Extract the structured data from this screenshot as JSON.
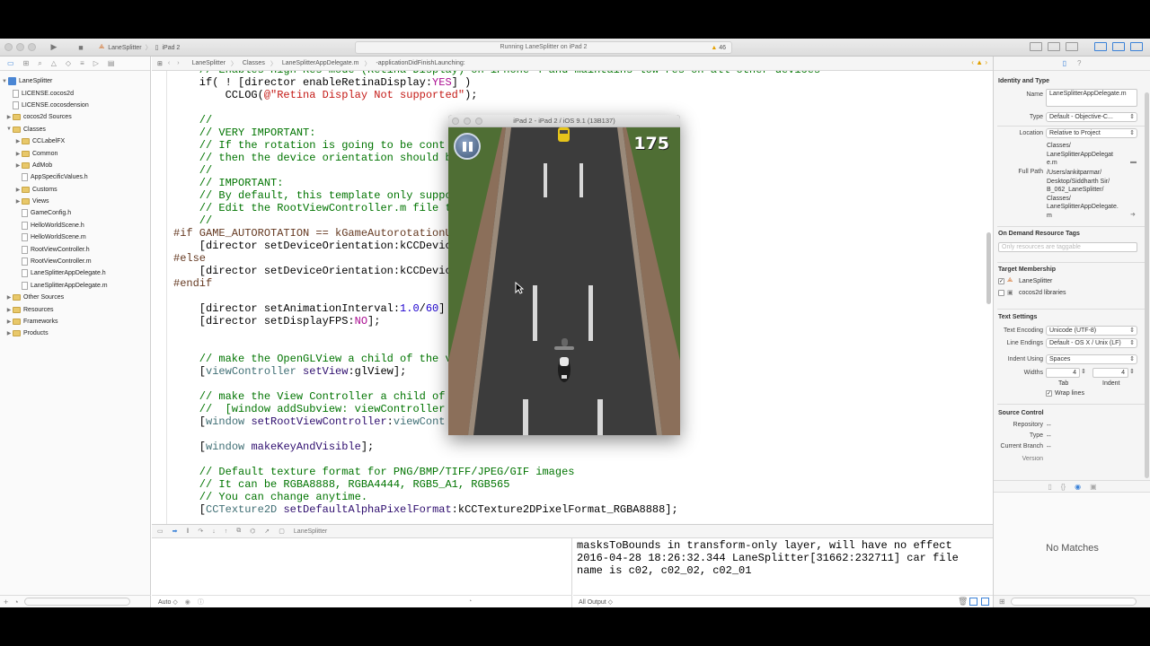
{
  "toolbar": {
    "scheme_target": "LaneSplitter",
    "scheme_device": "iPad 2",
    "activity": "Running LaneSplitter on iPad 2",
    "warnings": "46"
  },
  "jumpbar": {
    "crumbs": [
      "LaneSplitter",
      "Classes",
      "LaneSplitterAppDelegate.m",
      "-applicationDidFinishLaunching:"
    ]
  },
  "navigator": {
    "items": [
      {
        "label": "LaneSplitter",
        "kind": "project",
        "indent": 0,
        "open": true
      },
      {
        "label": "LICENSE.cocos2d",
        "kind": "file",
        "indent": 1
      },
      {
        "label": "LICENSE.cocosdension",
        "kind": "file",
        "indent": 1
      },
      {
        "label": "cocos2d Sources",
        "kind": "folder",
        "indent": 1,
        "open": false
      },
      {
        "label": "Classes",
        "kind": "folder",
        "indent": 1,
        "open": true
      },
      {
        "label": "CCLabelFX",
        "kind": "folder",
        "indent": 2,
        "open": false
      },
      {
        "label": "Common",
        "kind": "folder",
        "indent": 2,
        "open": false
      },
      {
        "label": "AdMob",
        "kind": "folder",
        "indent": 2,
        "open": false
      },
      {
        "label": "AppSpecificValues.h",
        "kind": "file",
        "indent": 2
      },
      {
        "label": "Customs",
        "kind": "folder",
        "indent": 2,
        "open": false
      },
      {
        "label": "Views",
        "kind": "folder",
        "indent": 2,
        "open": false
      },
      {
        "label": "GameConfig.h",
        "kind": "file",
        "indent": 2
      },
      {
        "label": "HelloWorldScene.h",
        "kind": "file",
        "indent": 2
      },
      {
        "label": "HelloWorldScene.m",
        "kind": "file",
        "indent": 2
      },
      {
        "label": "RootViewController.h",
        "kind": "file",
        "indent": 2
      },
      {
        "label": "RootViewController.m",
        "kind": "file",
        "indent": 2
      },
      {
        "label": "LaneSplitterAppDelegate.h",
        "kind": "file",
        "indent": 2
      },
      {
        "label": "LaneSplitterAppDelegate.m",
        "kind": "file",
        "indent": 2
      },
      {
        "label": "Other Sources",
        "kind": "folder",
        "indent": 1,
        "open": false
      },
      {
        "label": "Resources",
        "kind": "folder",
        "indent": 1,
        "open": false
      },
      {
        "label": "Frameworks",
        "kind": "folder",
        "indent": 1,
        "open": false
      },
      {
        "label": "Products",
        "kind": "folder",
        "indent": 1,
        "open": false
      }
    ]
  },
  "editor": {
    "lines": [
      [
        {
          "t": "    // Enables High Res mode (Retina Display) on iPhone 4 and maintains low res on all other devices",
          "c": "c"
        }
      ],
      [
        {
          "t": "    if( ! [director enableRetinaDisplay:",
          "c": ""
        },
        {
          "t": "YES",
          "c": "k"
        },
        {
          "t": "] )",
          "c": ""
        }
      ],
      [
        {
          "t": "        CCLOG(",
          "c": ""
        },
        {
          "t": "@\"Retina Display Not supported\"",
          "c": "s"
        },
        {
          "t": ");",
          "c": ""
        }
      ],
      [
        {
          "t": "",
          "c": ""
        }
      ],
      [
        {
          "t": "    //",
          "c": "c"
        }
      ],
      [
        {
          "t": "    // VERY IMPORTANT:",
          "c": "c"
        }
      ],
      [
        {
          "t": "    // If the rotation is going to be cont",
          "c": "c"
        }
      ],
      [
        {
          "t": "    // then the device orientation should b",
          "c": "c"
        }
      ],
      [
        {
          "t": "    //",
          "c": "c"
        }
      ],
      [
        {
          "t": "    // IMPORTANT:",
          "c": "c"
        }
      ],
      [
        {
          "t": "    // By default, this template only suppo",
          "c": "c"
        }
      ],
      [
        {
          "t": "    // Edit the RootViewController.m file t",
          "c": "c"
        }
      ],
      [
        {
          "t": "    //",
          "c": "c"
        }
      ],
      [
        {
          "t": "#if GAME_AUTOROTATION == kGameAutorotationU",
          "c": "p"
        }
      ],
      [
        {
          "t": "    [director setDeviceOrientation:kCCDevic",
          "c": ""
        }
      ],
      [
        {
          "t": "#else",
          "c": "p"
        }
      ],
      [
        {
          "t": "    [director setDeviceOrientation:kCCDevic",
          "c": ""
        }
      ],
      [
        {
          "t": "#endif",
          "c": "p"
        }
      ],
      [
        {
          "t": "",
          "c": ""
        }
      ],
      [
        {
          "t": "    [director setAnimationInterval:",
          "c": ""
        },
        {
          "t": "1.0",
          "c": "n"
        },
        {
          "t": "/",
          "c": ""
        },
        {
          "t": "60",
          "c": "n"
        },
        {
          "t": "]",
          "c": ""
        }
      ],
      [
        {
          "t": "    [director setDisplayFPS:",
          "c": ""
        },
        {
          "t": "NO",
          "c": "k"
        },
        {
          "t": "];",
          "c": ""
        }
      ],
      [
        {
          "t": "",
          "c": ""
        }
      ],
      [
        {
          "t": "",
          "c": ""
        }
      ],
      [
        {
          "t": "    // make the OpenGLView a child of the v",
          "c": "c"
        }
      ],
      [
        {
          "t": "    [",
          "c": ""
        },
        {
          "t": "viewController",
          "c": "t"
        },
        {
          "t": " ",
          "c": ""
        },
        {
          "t": "setView",
          "c": "m"
        },
        {
          "t": ":glView];",
          "c": ""
        }
      ],
      [
        {
          "t": "",
          "c": ""
        }
      ],
      [
        {
          "t": "    // make the View Controller a child of",
          "c": "c"
        }
      ],
      [
        {
          "t": "    //  [window addSubview: viewController",
          "c": "c"
        }
      ],
      [
        {
          "t": "    [",
          "c": ""
        },
        {
          "t": "window",
          "c": "t"
        },
        {
          "t": " ",
          "c": ""
        },
        {
          "t": "setRootViewController",
          "c": "m"
        },
        {
          "t": ":",
          "c": ""
        },
        {
          "t": "viewCont",
          "c": "t"
        }
      ],
      [
        {
          "t": "",
          "c": ""
        }
      ],
      [
        {
          "t": "    [",
          "c": ""
        },
        {
          "t": "window",
          "c": "t"
        },
        {
          "t": " ",
          "c": ""
        },
        {
          "t": "makeKeyAndVisible",
          "c": "m"
        },
        {
          "t": "];",
          "c": ""
        }
      ],
      [
        {
          "t": "",
          "c": ""
        }
      ],
      [
        {
          "t": "    // Default texture format for PNG/BMP/TIFF/JPEG/GIF images",
          "c": "c"
        }
      ],
      [
        {
          "t": "    // It can be RGBA8888, RGBA4444, RGB5_A1, RGB565",
          "c": "c"
        }
      ],
      [
        {
          "t": "    // You can change anytime.",
          "c": "c"
        }
      ],
      [
        {
          "t": "    [",
          "c": ""
        },
        {
          "t": "CCTexture2D",
          "c": "t"
        },
        {
          "t": " ",
          "c": ""
        },
        {
          "t": "setDefaultAlphaPixelFormat",
          "c": "m"
        },
        {
          "t": ":kCCTexture2DPixelFormat_RGBA8888];",
          "c": ""
        }
      ]
    ]
  },
  "debugbar": {
    "target": "LaneSplitter"
  },
  "variables": {
    "filter_label": "Auto ◇"
  },
  "console": {
    "text": "masksToBounds in transform-only layer, will have no effect\n2016-04-28 18:26:32.344 LaneSplitter[31662:232711] car file\nname is c02, c02_02, c02_01",
    "output_label": "All Output ◇"
  },
  "inspector": {
    "identity_title": "Identity and Type",
    "name_label": "Name",
    "name_value": "LaneSplitterAppDelegate.m",
    "type_label": "Type",
    "type_value": "Default - Objective-C...",
    "location_label": "Location",
    "location_value": "Relative to Project",
    "location_path": "Classes/\nLaneSplitterAppDelegat\ne.m",
    "full_path_label": "Full Path",
    "full_path_value": "/Users/ankitparmar/\nDesktop/Siddharth Sir/\nB_062_LaneSplitter/\nClasses/\nLaneSplitterAppDelegate.\nm",
    "ondemand_title": "On Demand Resource Tags",
    "ondemand_placeholder": "Only resources are taggable",
    "target_title": "Target Membership",
    "targets": [
      {
        "label": "LaneSplitter",
        "checked": true
      },
      {
        "label": "cocos2d libraries",
        "checked": false
      }
    ],
    "text_settings_title": "Text Settings",
    "encoding_label": "Text Encoding",
    "encoding_value": "Unicode (UTF-8)",
    "line_endings_label": "Line Endings",
    "line_endings_value": "Default - OS X / Unix (LF)",
    "indent_label": "Indent Using",
    "indent_value": "Spaces",
    "widths_label": "Widths",
    "tab_width": "4",
    "indent_width": "4",
    "tab_caption": "Tab",
    "indent_caption": "Indent",
    "wrap_label": "Wrap lines",
    "source_control_title": "Source Control",
    "repository_label": "Repository",
    "repository_value": "--",
    "sc_type_label": "Type",
    "sc_type_value": "--",
    "branch_label": "Current Branch",
    "branch_value": "--",
    "version_label": "Version",
    "no_matches": "No Matches"
  },
  "simulator": {
    "title": "iPad 2 - iPad 2 / iOS 9.1 (13B137)",
    "score": "175"
  },
  "colors": {
    "accent": "#3b82d8",
    "warning": "#e5a000",
    "comment": "#007400",
    "preprocessor": "#643820",
    "string": "#c41a16",
    "keyword": "#aa0d91"
  }
}
